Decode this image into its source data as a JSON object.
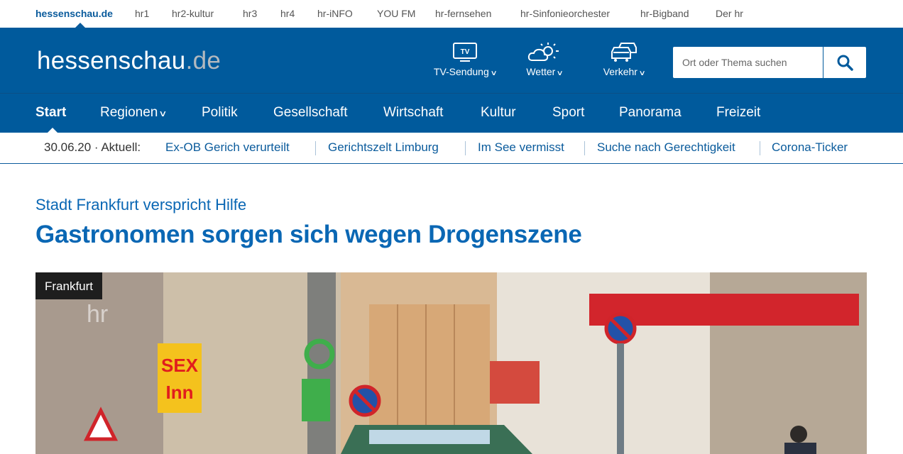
{
  "network": {
    "items": [
      {
        "label": "hessenschau.de",
        "active": true
      },
      {
        "label": "hr1"
      },
      {
        "label": "hr2-kultur"
      },
      {
        "label": "hr3"
      },
      {
        "label": "hr4"
      },
      {
        "label": "hr-iNFO"
      },
      {
        "label": "YOU FM"
      },
      {
        "label": "hr-fernsehen"
      },
      {
        "label": "hr-Sinfonieorchester"
      },
      {
        "label": "hr-Bigband"
      },
      {
        "label": "Der hr"
      }
    ]
  },
  "header": {
    "logo_main": "hessenschau",
    "logo_tld": ".de",
    "services": [
      {
        "label": "TV-Sendung",
        "icon": "tv-icon"
      },
      {
        "label": "Wetter",
        "icon": "weather-icon"
      },
      {
        "label": "Verkehr",
        "icon": "traffic-icon"
      }
    ],
    "search_placeholder": "Ort oder Thema suchen"
  },
  "mainnav": {
    "items": [
      {
        "label": "Start",
        "active": true
      },
      {
        "label": "Regionen",
        "dropdown": true
      },
      {
        "label": "Politik"
      },
      {
        "label": "Gesellschaft"
      },
      {
        "label": "Wirtschaft"
      },
      {
        "label": "Kultur"
      },
      {
        "label": "Sport"
      },
      {
        "label": "Panorama"
      },
      {
        "label": "Freizeit"
      }
    ]
  },
  "ticker": {
    "date_label": "30.06.20 · Aktuell:",
    "links": [
      "Ex-OB Gerich verurteilt",
      "Gerichtszelt Limburg",
      "Im See vermisst",
      "Suche nach Gerechtigkeit",
      "Corona-Ticker"
    ]
  },
  "article": {
    "kicker": "Stadt Frankfurt verspricht Hilfe",
    "headline": "Gastronomen sorgen sich wegen Drogenszene",
    "image_tag": "Frankfurt"
  },
  "colors": {
    "brand_blue": "#005a9c",
    "link_blue": "#0a5b9c",
    "headline_blue": "#0a67b4"
  }
}
